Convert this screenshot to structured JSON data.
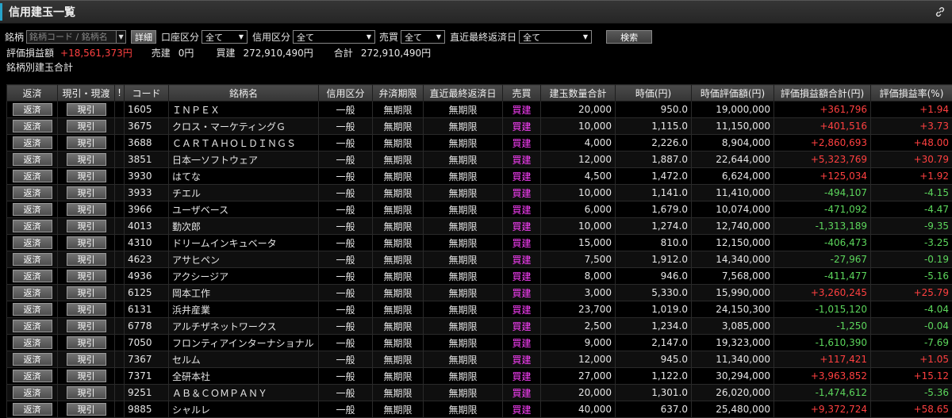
{
  "title": "信用建玉一覧",
  "filters": {
    "meigara_label": "銘柄",
    "meigara_placeholder": "銘柄コード / 銘柄名",
    "detail_label": "詳細",
    "account_label": "口座区分",
    "account_value": "全て",
    "credit_label": "信用区分",
    "credit_value": "全て",
    "trade_label": "売買",
    "trade_value": "全て",
    "due_label": "直近最終返済日",
    "due_value": "全て",
    "search_label": "検索"
  },
  "summary": {
    "pl_label": "評価損益額",
    "pl_value": "+18,561,373円",
    "sell_label": "売建",
    "sell_value": "0円",
    "buy_label": "買建",
    "buy_value": "272,910,490円",
    "total_label": "合計",
    "total_value": "272,910,490円"
  },
  "section_label": "銘柄別建玉合計",
  "columns": [
    "返済",
    "現引・現渡",
    "!",
    "コード",
    "銘柄名",
    "信用区分",
    "弁済期限",
    "直近最終返済日",
    "売買",
    "建玉数量合計",
    "時価(円)",
    "時価評価額(円)",
    "評価損益額合計(円)",
    "評価損益率(%)"
  ],
  "repay_label": "返済",
  "genbiki_label": "現引",
  "rows": [
    {
      "code": "1605",
      "name": "ＩＮＰＥＸ",
      "kubun": "一般",
      "kigen": "無期限",
      "due": "無期限",
      "side": "買建",
      "qty": "20,000",
      "price": "950.0",
      "value": "19,000,000",
      "pl": "+361,796",
      "rate": "+1.94",
      "sign": "pos"
    },
    {
      "code": "3675",
      "name": "クロス・マーケティングＧ",
      "kubun": "一般",
      "kigen": "無期限",
      "due": "無期限",
      "side": "買建",
      "qty": "10,000",
      "price": "1,115.0",
      "value": "11,150,000",
      "pl": "+401,516",
      "rate": "+3.73",
      "sign": "pos"
    },
    {
      "code": "3688",
      "name": "ＣＡＲＴＡＨＯＬＤＩＮＧＳ",
      "kubun": "一般",
      "kigen": "無期限",
      "due": "無期限",
      "side": "買建",
      "qty": "4,000",
      "price": "2,226.0",
      "value": "8,904,000",
      "pl": "+2,860,693",
      "rate": "+48.00",
      "sign": "pos"
    },
    {
      "code": "3851",
      "name": "日本一ソフトウェア",
      "kubun": "一般",
      "kigen": "無期限",
      "due": "無期限",
      "side": "買建",
      "qty": "12,000",
      "price": "1,887.0",
      "value": "22,644,000",
      "pl": "+5,323,769",
      "rate": "+30.79",
      "sign": "pos"
    },
    {
      "code": "3930",
      "name": "はてな",
      "kubun": "一般",
      "kigen": "無期限",
      "due": "無期限",
      "side": "買建",
      "qty": "4,500",
      "price": "1,472.0",
      "value": "6,624,000",
      "pl": "+125,034",
      "rate": "+1.92",
      "sign": "pos"
    },
    {
      "code": "3933",
      "name": "チエル",
      "kubun": "一般",
      "kigen": "無期限",
      "due": "無期限",
      "side": "買建",
      "qty": "10,000",
      "price": "1,141.0",
      "value": "11,410,000",
      "pl": "-494,107",
      "rate": "-4.15",
      "sign": "neg"
    },
    {
      "code": "3966",
      "name": "ユーザベース",
      "kubun": "一般",
      "kigen": "無期限",
      "due": "無期限",
      "side": "買建",
      "qty": "6,000",
      "price": "1,679.0",
      "value": "10,074,000",
      "pl": "-471,092",
      "rate": "-4.47",
      "sign": "neg"
    },
    {
      "code": "4013",
      "name": "勤次郎",
      "kubun": "一般",
      "kigen": "無期限",
      "due": "無期限",
      "side": "買建",
      "qty": "10,000",
      "price": "1,274.0",
      "value": "12,740,000",
      "pl": "-1,313,189",
      "rate": "-9.35",
      "sign": "neg"
    },
    {
      "code": "4310",
      "name": "ドリームインキュベータ",
      "kubun": "一般",
      "kigen": "無期限",
      "due": "無期限",
      "side": "買建",
      "qty": "15,000",
      "price": "810.0",
      "value": "12,150,000",
      "pl": "-406,473",
      "rate": "-3.25",
      "sign": "neg"
    },
    {
      "code": "4623",
      "name": "アサヒペン",
      "kubun": "一般",
      "kigen": "無期限",
      "due": "無期限",
      "side": "買建",
      "qty": "7,500",
      "price": "1,912.0",
      "value": "14,340,000",
      "pl": "-27,967",
      "rate": "-0.19",
      "sign": "neg"
    },
    {
      "code": "4936",
      "name": "アクシージア",
      "kubun": "一般",
      "kigen": "無期限",
      "due": "無期限",
      "side": "買建",
      "qty": "8,000",
      "price": "946.0",
      "value": "7,568,000",
      "pl": "-411,477",
      "rate": "-5.16",
      "sign": "neg"
    },
    {
      "code": "6125",
      "name": "岡本工作",
      "kubun": "一般",
      "kigen": "無期限",
      "due": "無期限",
      "side": "買建",
      "qty": "3,000",
      "price": "5,330.0",
      "value": "15,990,000",
      "pl": "+3,260,245",
      "rate": "+25.79",
      "sign": "pos"
    },
    {
      "code": "6131",
      "name": "浜井産業",
      "kubun": "一般",
      "kigen": "無期限",
      "due": "無期限",
      "side": "買建",
      "qty": "23,700",
      "price": "1,019.0",
      "value": "24,150,300",
      "pl": "-1,015,120",
      "rate": "-4.04",
      "sign": "neg"
    },
    {
      "code": "6778",
      "name": "アルチザネットワークス",
      "kubun": "一般",
      "kigen": "無期限",
      "due": "無期限",
      "side": "買建",
      "qty": "2,500",
      "price": "1,234.0",
      "value": "3,085,000",
      "pl": "-1,250",
      "rate": "-0.04",
      "sign": "neg"
    },
    {
      "code": "7050",
      "name": "フロンティアインターナショナル",
      "kubun": "一般",
      "kigen": "無期限",
      "due": "無期限",
      "side": "買建",
      "qty": "9,000",
      "price": "2,147.0",
      "value": "19,323,000",
      "pl": "-1,610,390",
      "rate": "-7.69",
      "sign": "neg"
    },
    {
      "code": "7367",
      "name": "セルム",
      "kubun": "一般",
      "kigen": "無期限",
      "due": "無期限",
      "side": "買建",
      "qty": "12,000",
      "price": "945.0",
      "value": "11,340,000",
      "pl": "+117,421",
      "rate": "+1.05",
      "sign": "pos"
    },
    {
      "code": "7371",
      "name": "全研本社",
      "kubun": "一般",
      "kigen": "無期限",
      "due": "無期限",
      "side": "買建",
      "qty": "27,000",
      "price": "1,122.0",
      "value": "30,294,000",
      "pl": "+3,963,852",
      "rate": "+15.12",
      "sign": "pos"
    },
    {
      "code": "9251",
      "name": "ＡＢ＆ＣＯＭＰＡＮＹ",
      "kubun": "一般",
      "kigen": "無期限",
      "due": "無期限",
      "side": "買建",
      "qty": "20,000",
      "price": "1,301.0",
      "value": "26,020,000",
      "pl": "-1,474,612",
      "rate": "-5.36",
      "sign": "neg"
    },
    {
      "code": "9885",
      "name": "シャルレ",
      "kubun": "一般",
      "kigen": "無期限",
      "due": "無期限",
      "side": "買建",
      "qty": "40,000",
      "price": "637.0",
      "value": "25,480,000",
      "pl": "+9,372,724",
      "rate": "+58.65",
      "sign": "pos"
    }
  ]
}
